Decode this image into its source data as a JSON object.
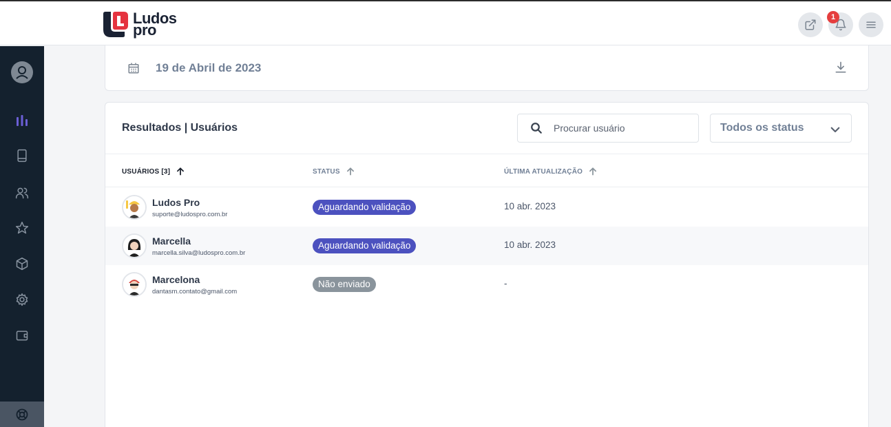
{
  "brand": {
    "line1": "Ludos",
    "line2": "pro"
  },
  "header": {
    "external_link_icon": "external-link-icon",
    "notifications": {
      "icon": "bell-icon",
      "count": "1"
    },
    "menu_icon": "hamburger-menu-icon"
  },
  "sidebar": {
    "items": [
      {
        "icon": "user-avatar-icon",
        "active": false
      },
      {
        "icon": "bar-chart-icon",
        "active": true
      },
      {
        "icon": "book-icon",
        "active": false
      },
      {
        "icon": "users-icon",
        "active": false
      },
      {
        "icon": "star-icon",
        "active": false
      },
      {
        "icon": "cube-icon",
        "active": false
      },
      {
        "icon": "gear-icon",
        "active": false
      },
      {
        "icon": "wallet-icon",
        "active": false
      },
      {
        "icon": "help-lifebuoy-icon",
        "active": false
      }
    ]
  },
  "date_card": {
    "date": "19 de Abril de 2023"
  },
  "results": {
    "title": "Resultados | Usuários",
    "search_placeholder": "Procurar usuário",
    "status_filter": "Todos os status",
    "columns": {
      "users": "USUÁRIOS [3]",
      "status": "STATUS",
      "updated": "ÚLTIMA ATUALIZAÇÃO"
    },
    "rows": [
      {
        "name": "Ludos Pro",
        "email": "suporte@ludospro.com.br",
        "status": "Aguardando validação",
        "updated": "10 abr. 2023"
      },
      {
        "name": "Marcella",
        "email": "marcella.silva@ludospro.com.br",
        "status": "Aguardando validação",
        "updated": "10 abr. 2023"
      },
      {
        "name": "Marcelona",
        "email": "dantasm.contato@gmail.com",
        "status": "Não enviado",
        "updated": "-"
      }
    ]
  },
  "colors": {
    "sidebar_bg": "#14212e",
    "accent": "#4c51bf",
    "brand_red": "#e5333f",
    "muted_badge": "#8a949c"
  }
}
